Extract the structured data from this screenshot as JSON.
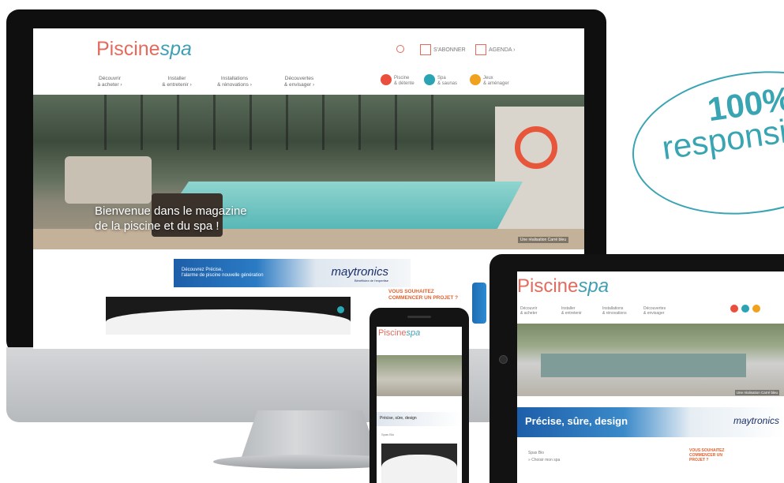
{
  "badge": {
    "line1": "100%",
    "line2": "responsive"
  },
  "brand": {
    "part1": "Piscine",
    "part2": "spa"
  },
  "desktop": {
    "header": {
      "signup_label": "S'ABONNER",
      "agenda_label": "AGENDA ›"
    },
    "nav": [
      "Découvrir\nà acheter ›",
      "Installer\n& entretenir ›",
      "Installations\n& rénovations ›",
      "Découvertes\n& envisager ›"
    ],
    "circles": [
      {
        "label": "Piscine\n& détente",
        "color": "#e94f3c"
      },
      {
        "label": "Spa\n& saunas",
        "color": "#2aa3b3"
      },
      {
        "label": "Jeux\n& aménager",
        "color": "#f0a21e"
      }
    ],
    "hero": {
      "headline": "Bienvenue dans le magazine\nde la piscine et du spa !",
      "credit": "Une réalisation Carré bleu"
    },
    "banner": {
      "text": "Découvrez Précise,\nl'alarme de piscine nouvelle génération",
      "brand": "maytronics",
      "brand_sub": "Bénéficiez de l'expertise"
    },
    "promo": "VOUS SOUHAITEZ\nCOMMENCER UN PROJET ?"
  },
  "tablet": {
    "nav": [
      "Découvrir\n& acheter",
      "Installer\n& entretenir",
      "Installations\n& rénovations",
      "Découvertes\n& envisager"
    ],
    "credit": "Une réalisation Carré bleu",
    "banner_text": "Précise, sûre, design",
    "banner_brand": "maytronics",
    "meta": "Spas   Bio\n» Choisir mon spa",
    "promo": "VOUS SOUHAITEZ\nCOMMENCER UN\nPROJET ?"
  },
  "phone": {
    "banner_text": "Précise, sûre, design",
    "tabs": "Spas   Bio"
  }
}
